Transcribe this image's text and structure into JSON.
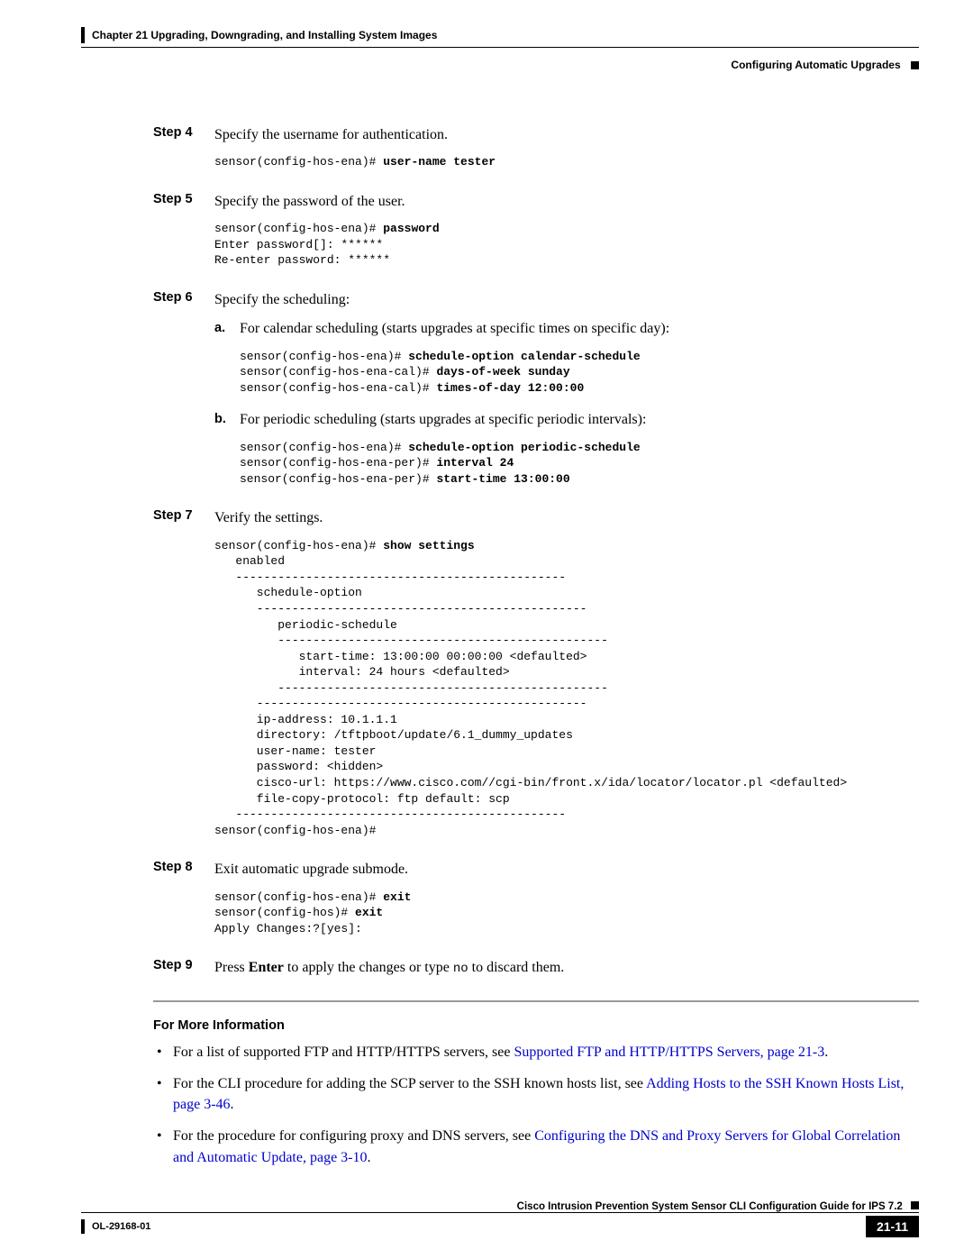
{
  "header": {
    "chapter": "Chapter 21    Upgrading, Downgrading, and Installing System Images",
    "section": "Configuring Automatic Upgrades"
  },
  "steps": {
    "s4": {
      "label": "Step 4",
      "text": "Specify the username for authentication.",
      "code_prompt": "sensor(config-hos-ena)# ",
      "code_cmd": "user-name tester"
    },
    "s5": {
      "label": "Step 5",
      "text": "Specify the password of the user.",
      "code_prompt": "sensor(config-hos-ena)# ",
      "code_cmd": "password",
      "code_line2": "Enter password[]: ******",
      "code_line3": "Re-enter password: ******"
    },
    "s6": {
      "label": "Step 6",
      "text": "Specify the scheduling:",
      "a": {
        "label": "a.",
        "text": "For calendar scheduling (starts upgrades at specific times on specific day):",
        "l1p": "sensor(config-hos-ena)# ",
        "l1c": "schedule-option calendar-schedule",
        "l2p": "sensor(config-hos-ena-cal)# ",
        "l2c": "days-of-week sunday",
        "l3p": "sensor(config-hos-ena-cal)# ",
        "l3c": "times-of-day 12:00:00"
      },
      "b": {
        "label": "b.",
        "text": "For periodic scheduling (starts upgrades at specific periodic intervals):",
        "l1p": "sensor(config-hos-ena)# ",
        "l1c": "schedule-option periodic-schedule",
        "l2p": "sensor(config-hos-ena-per)# ",
        "l2c": "interval 24",
        "l3p": "sensor(config-hos-ena-per)# ",
        "l3c": "start-time 13:00:00"
      }
    },
    "s7": {
      "label": "Step 7",
      "text": "Verify the settings.",
      "code_prompt": "sensor(config-hos-ena)# ",
      "code_cmd": "show settings",
      "output": "   enabled\n   -----------------------------------------------\n      schedule-option\n      -----------------------------------------------\n         periodic-schedule\n         -----------------------------------------------\n            start-time: 13:00:00 00:00:00 <defaulted>\n            interval: 24 hours <defaulted>\n         -----------------------------------------------\n      -----------------------------------------------\n      ip-address: 10.1.1.1\n      directory: /tftpboot/update/6.1_dummy_updates\n      user-name: tester\n      password: <hidden>\n      cisco-url: https://www.cisco.com//cgi-bin/front.x/ida/locator/locator.pl <defaulted>\n      file-copy-protocol: ftp default: scp\n   -----------------------------------------------\nsensor(config-hos-ena)#"
    },
    "s8": {
      "label": "Step 8",
      "text": "Exit automatic upgrade submode.",
      "l1p": "sensor(config-hos-ena)# ",
      "l1c": "exit",
      "l2p": "sensor(config-hos)# ",
      "l2c": "exit",
      "l3": "Apply Changes:?[yes]:"
    },
    "s9": {
      "label": "Step 9",
      "pre": "Press ",
      "enter": "Enter",
      "mid": " to apply the changes or type ",
      "no": "no",
      "post": " to discard them."
    }
  },
  "fmi": {
    "heading": "For More Information",
    "b1_pre": "For a list of supported FTP and HTTP/HTTPS servers, see ",
    "b1_link": "Supported FTP and HTTP/HTTPS Servers, page 21-3",
    "b1_post": ".",
    "b2_pre": "For the CLI procedure for adding the SCP server to the SSH known hosts list, see ",
    "b2_link": "Adding Hosts to the SSH Known Hosts List, page 3-46",
    "b2_post": ".",
    "b3_pre": "For the procedure for configuring proxy and DNS servers, see ",
    "b3_link": "Configuring the DNS and Proxy Servers for Global Correlation and Automatic Update, page 3-10",
    "b3_post": "."
  },
  "footer": {
    "doc_title": "Cisco Intrusion Prevention System Sensor CLI Configuration Guide for IPS 7.2",
    "doc_id": "OL-29168-01",
    "page_num": "21-11"
  }
}
